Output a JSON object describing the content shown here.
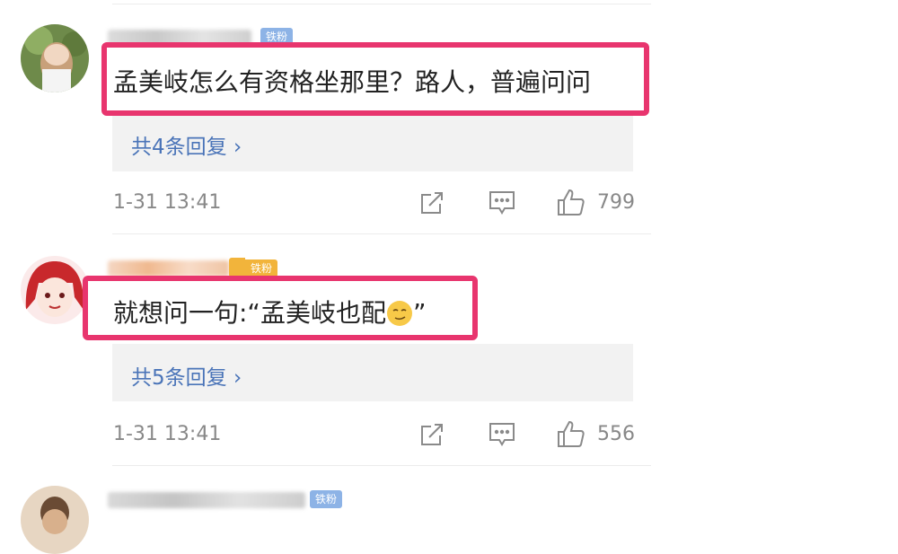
{
  "comments": [
    {
      "badge": "铁粉",
      "text": "孟美岐怎么有资格坐那里？路人，普遍问问",
      "reply_link": "共4条回复 ›",
      "time": "1-31 13:41",
      "likes": "799",
      "colors": {
        "badge": "#8db3e6"
      }
    },
    {
      "badge": "铁粉",
      "text": "就想问一句:“孟美岐也配",
      "text_end": "”",
      "emoji": "smirk-emoji",
      "reply_link": "共5条回复 ›",
      "time": "1-31 13:41",
      "likes": "556",
      "colors": {
        "badge": "#f2b43b"
      }
    },
    {
      "badge": "铁粉",
      "colors": {
        "badge": "#8db3e6"
      }
    }
  ],
  "colors": {
    "highlight": "#e8356e",
    "link": "#4a74b8",
    "meta": "#888888"
  }
}
